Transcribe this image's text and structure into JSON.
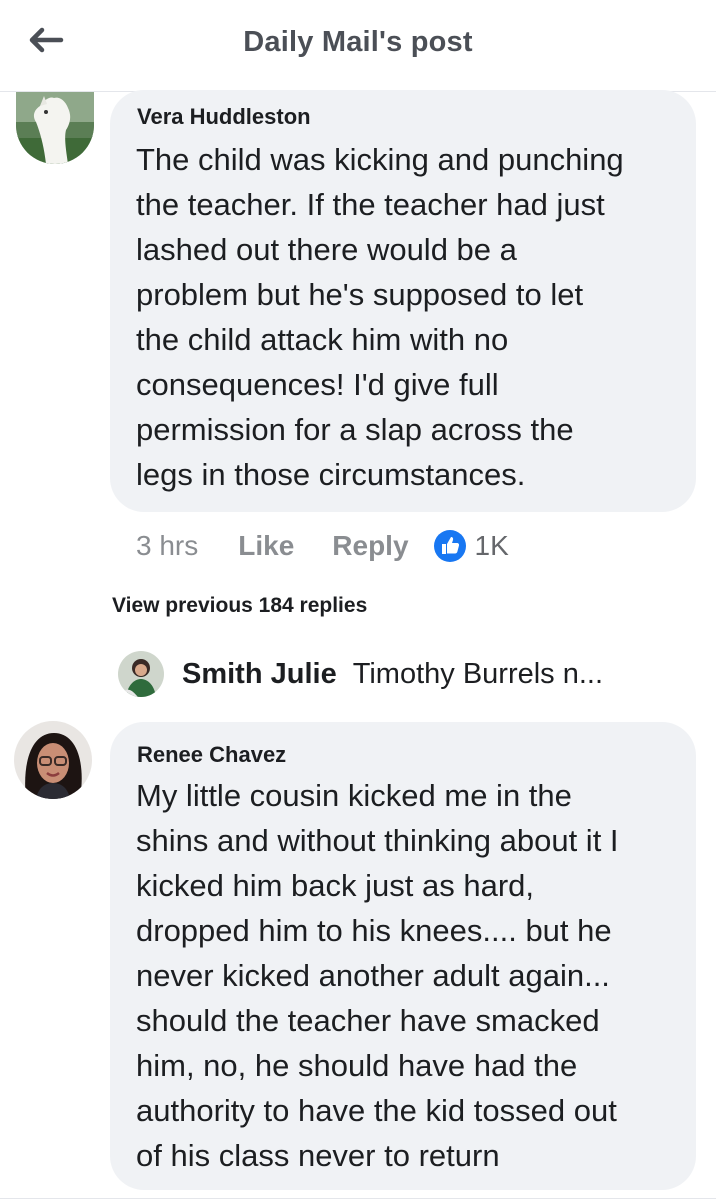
{
  "header": {
    "title": "Daily Mail's post",
    "back_icon": "back-arrow-icon"
  },
  "comments": [
    {
      "author": "Vera Huddleston",
      "text": "The child was kicking and punching\nthe teacher.  If the teacher had just\nlashed out there would be a\nproblem but he's supposed to let\nthe child attack him with no\nconsequences!  I'd give full\npermission for a slap across the\nlegs in those circumstances.",
      "time": "3 hrs",
      "like_label": "Like",
      "reply_label": "Reply",
      "reaction_icon": "thumbs-up-icon",
      "reaction_count": "1K"
    },
    {
      "author": "Renee Chavez",
      "text": "My little cousin kicked me in the\nshins and without thinking about it I\nkicked him back just as hard,\ndropped him to his knees.... but he\nnever kicked another adult again...\nshould the teacher have smacked\nhim, no, he should have had the\nauthority to have the kid tossed out\nof his class never to return"
    }
  ],
  "replies": {
    "view_previous_label": "View previous 184 replies",
    "preview_author": "Smith Julie",
    "preview_text": "Timothy Burrels n..."
  },
  "colors": {
    "bubble": "#f0f2f5",
    "like_blue": "#1877f2",
    "muted_text": "#8a8d91"
  }
}
